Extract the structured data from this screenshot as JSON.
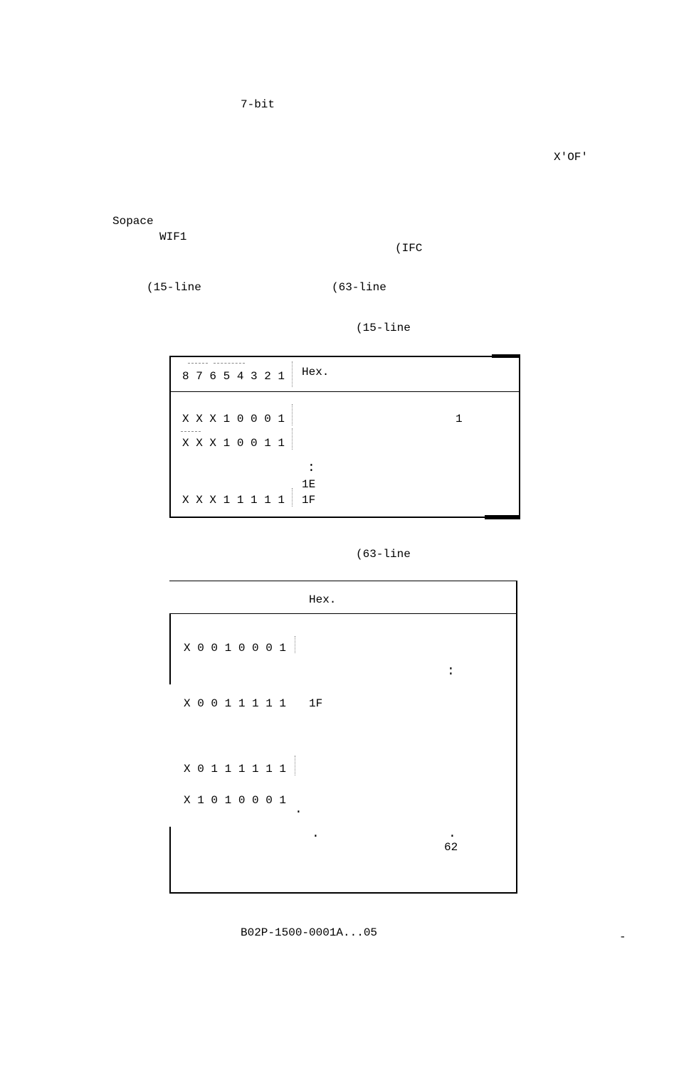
{
  "labels": {
    "seven_bit": "7-bit",
    "x0f": "X'OF'",
    "sopace": "Sopace",
    "wif1": "WIF1",
    "ifc": "(IFC",
    "l15_a": "(15-line",
    "l63_a": "(63-line",
    "l15_b": "(15-line",
    "l63_b": "(63-line",
    "footer": "B02P-1500-0001A...05",
    "dash": "-"
  },
  "table15": {
    "header_bits": "8 7 6 5 4 3 2 1",
    "header_hex": "Hex.",
    "rows": [
      {
        "bits": "X X X 1 0 0 0 1",
        "hex": "",
        "right": "1"
      },
      {
        "bits": "X X X 1 0 0 1 1",
        "hex": "",
        "right": ""
      },
      {
        "bits": "",
        "hex": "1E",
        "right": ""
      },
      {
        "bits": "X X X 1 1 1 1 1",
        "hex": "1F",
        "right": ""
      }
    ],
    "vellipsis": ":"
  },
  "table63": {
    "header_hex": "Hex.",
    "rows": [
      {
        "bits": "X 0 0 1 0 0 0 1",
        "hex": ""
      },
      {
        "bits": "X 0 0 1 1 1 1 1",
        "hex": "1F"
      },
      {
        "bits": "X 0 1 1 1 1 1 1",
        "hex": ""
      },
      {
        "bits": "X 1 0 1 0 0 0 1",
        "hex": ""
      }
    ],
    "right_dots_top": ":",
    "right_val": "62",
    "mid_dot": ".",
    "right_dot_bottom": "."
  }
}
